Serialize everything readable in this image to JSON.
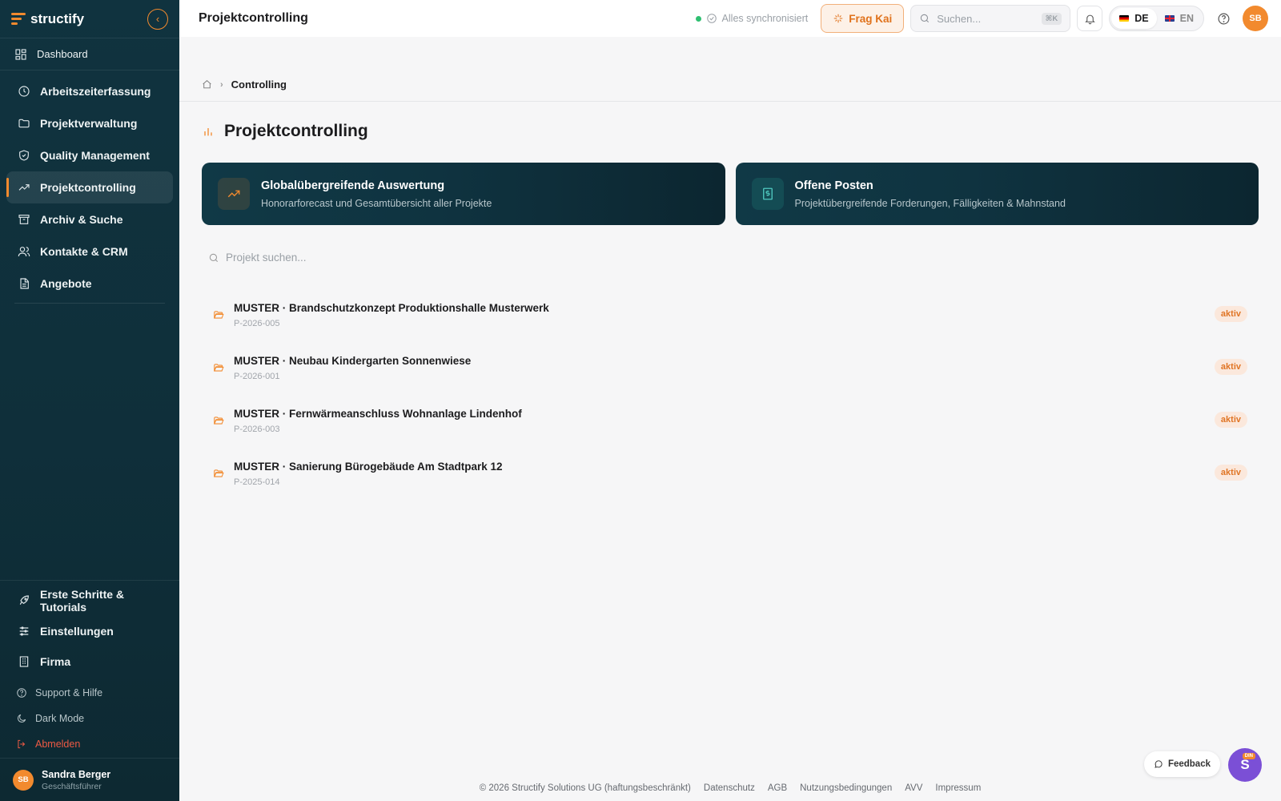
{
  "app": {
    "logo_text": "structify",
    "accent": "#f28a2e"
  },
  "sidebar": {
    "dashboard": "Dashboard",
    "items": [
      {
        "label": "Arbeitszeiterfassung",
        "icon": "clock-icon"
      },
      {
        "label": "Projektverwaltung",
        "icon": "folder-icon"
      },
      {
        "label": "Quality Management",
        "icon": "shield-check-icon"
      },
      {
        "label": "Projektcontrolling",
        "icon": "trending-up-icon",
        "active": true
      },
      {
        "label": "Archiv & Suche",
        "icon": "archive-icon"
      },
      {
        "label": "Kontakte & CRM",
        "icon": "users-icon"
      },
      {
        "label": "Angebote",
        "icon": "document-icon"
      }
    ],
    "bottom_items": [
      {
        "label": "Erste Schritte & Tutorials",
        "icon": "rocket-icon"
      },
      {
        "label": "Einstellungen",
        "icon": "sliders-icon"
      },
      {
        "label": "Firma",
        "icon": "building-icon"
      }
    ],
    "support": "Support & Hilfe",
    "dark_mode": "Dark Mode",
    "logout": "Abmelden",
    "user": {
      "initials": "SB",
      "name": "Sandra Berger",
      "role": "Geschäftsführer"
    }
  },
  "topbar": {
    "title": "Projektcontrolling",
    "sync_status": "Alles synchronisiert",
    "ask_button": "Frag Kai",
    "search_placeholder": "Suchen...",
    "search_shortcut": "⌘K",
    "lang_de": "DE",
    "lang_en": "EN",
    "avatar_initials": "SB"
  },
  "breadcrumb": {
    "current": "Controlling"
  },
  "page": {
    "title": "Projektcontrolling",
    "cards": [
      {
        "title": "Globalübergreifende Auswertung",
        "subtitle": "Honorarforecast und Gesamtübersicht aller Projekte"
      },
      {
        "title": "Offene Posten",
        "subtitle": "Projektübergreifende Forderungen, Fälligkeiten & Mahnstand"
      }
    ],
    "project_search_placeholder": "Projekt suchen...",
    "projects": [
      {
        "name": "MUSTER · Brandschutzkonzept Produktionshalle Musterwerk",
        "id": "P-2026-005",
        "status": "aktiv"
      },
      {
        "name": "MUSTER · Neubau Kindergarten Sonnenwiese",
        "id": "P-2026-001",
        "status": "aktiv"
      },
      {
        "name": "MUSTER · Fernwärmeanschluss Wohnanlage Lindenhof",
        "id": "P-2026-003",
        "status": "aktiv"
      },
      {
        "name": "MUSTER · Sanierung Bürogebäude Am Stadtpark 12",
        "id": "P-2025-014",
        "status": "aktiv"
      }
    ]
  },
  "footer": {
    "copyright": "© 2026 Structify Solutions UG (haftungsbeschränkt)",
    "links": [
      "Datenschutz",
      "AGB",
      "Nutzungsbedingungen",
      "AVV",
      "Impressum"
    ]
  },
  "widgets": {
    "feedback": "Feedback",
    "bot_letter": "S",
    "bot_badge": "DIN"
  }
}
